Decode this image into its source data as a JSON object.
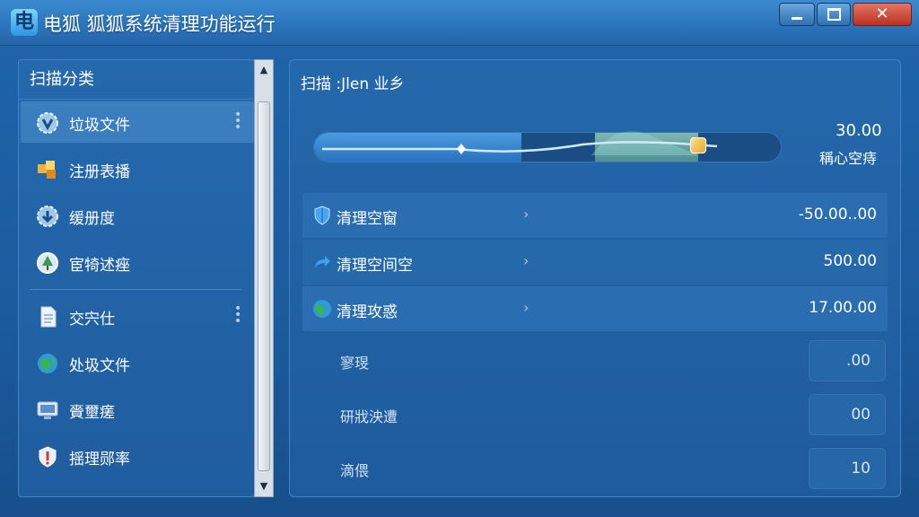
{
  "window": {
    "logo_glyph": "电",
    "title": "电狐  狐狐系统清理功能运行",
    "controls": {
      "minimize": "minimize-icon",
      "maximize": "maximize-icon",
      "close": "✕"
    }
  },
  "sidebar": {
    "header": "扫描分类",
    "items": [
      {
        "label": "垃圾文件",
        "icon": "gear-shield-icon",
        "active": true,
        "has_menu": true
      },
      {
        "label": "注册表播",
        "icon": "registry-cubes-icon"
      },
      {
        "label": "缓册度",
        "icon": "gear-down-icon"
      },
      {
        "label": "宦犄述痤",
        "icon": "globe-tree-icon"
      },
      {
        "label": "交宍仕",
        "icon": "document-icon",
        "has_menu": true
      },
      {
        "label": "处圾文件",
        "icon": "green-globe-icon"
      },
      {
        "label": "賫壐瘥",
        "icon": "monitor-icon"
      },
      {
        "label": "揺理郧率",
        "icon": "shield-bubble-icon"
      }
    ]
  },
  "scan": {
    "title": "扫描 :Jlen 业乡",
    "progress": 0.82,
    "value": "30.00",
    "caption": "稱心空痔"
  },
  "details": [
    {
      "label": "清理空窗",
      "icon": "blue-shield-icon",
      "value": "-50.00..00"
    },
    {
      "label": "清理空间空",
      "icon": "arrow-icon",
      "value": "500.00"
    },
    {
      "label": "清理攻惑",
      "icon": "green-globe-icon",
      "value": "17.00.00"
    }
  ],
  "subrows": [
    {
      "label": "寥琝",
      "value": ".00"
    },
    {
      "label": "研戕泱遭",
      "value": "00"
    },
    {
      "label": "滴偎",
      "value": "10"
    }
  ],
  "colors": {
    "accent": "#2a76bf",
    "active": "#3a7ec0",
    "close": "#c53b29"
  }
}
